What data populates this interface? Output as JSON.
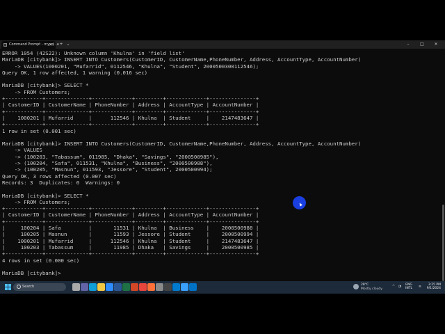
{
  "window": {
    "tab_title": "Command Prompt - mysql -u",
    "close_tab": "×",
    "new_tab": "+",
    "dropdown": "⌄",
    "minimize": "–",
    "maximize": "□",
    "close": "✕"
  },
  "console": {
    "lines": [
      "ERROR 1054 (42S22): Unknown column 'Khulna' in 'field list'",
      "MariaDB [citybank]> INSERT INTO Customers(CustomerID, CustomerName,PhoneNumber, Address, AccountType, AccountNumber)",
      "    -> VALUES(1000201, \"Mufarrid\", 0112546, \"Khulna\", \"Student\", 2000500300112546);",
      "Query OK, 1 row affected, 1 warning (0.016 sec)",
      "",
      "MariaDB [citybank]> SELECT *",
      "    -> FROM Customers;",
      "+------------+--------------+-------------+---------+-------------+---------------+",
      "| CustomerID | CustomerName | PhoneNumber | Address | AccountType | AccountNumber |",
      "+------------+--------------+-------------+---------+-------------+---------------+",
      "|    1000201 | Mufarrid     |      112546 | Khulna  | Student     |    2147483647 |",
      "+------------+--------------+-------------+---------+-------------+---------------+",
      "1 row in set (0.001 sec)",
      "",
      "MariaDB [citybank]> INSERT INTO Customers(CustomerID, CustomerName,PhoneNumber, Address, AccountType, AccountNumber)",
      "    -> VALUES",
      "    -> (100203, \"Tabassum\", 011985, \"Dhaka\", \"Savings\", \"2000500985\"),",
      "    -> (100204, \"Safa\", 011531, \"Khulna\", \"Business\", \"2000500988\"),",
      "    -> (100205, \"Masnun\", 011593, \"Jessore\", \"Student\", 2000500994);",
      "Query OK, 3 rows affected (0.007 sec)",
      "Records: 3  Duplicates: 0  Warnings: 0",
      "",
      "MariaDB [citybank]> SELECT *",
      "    -> FROM Customers;",
      "+------------+--------------+-------------+---------+-------------+---------------+",
      "| CustomerID | CustomerName | PhoneNumber | Address | AccountType | AccountNumber |",
      "+------------+--------------+-------------+---------+-------------+---------------+",
      "|     100204 | Safa         |       11531 | Khulna  | Business    |    2000500988 |",
      "|     100205 | Masnun       |       11593 | Jessore | Student     |    2000500994 |",
      "|    1000201 | Mufarrid     |      112546 | Khulna  | Student     |    2147483647 |",
      "|     100203 | Tabassum     |       11985 | Dhaka   | Savings     |    2000500985 |",
      "+------------+--------------+-------------+---------+-------------+---------------+",
      "4 rows in set (0.000 sec)",
      "",
      "MariaDB [citybank]> "
    ]
  },
  "taskbar": {
    "search_label": "Search",
    "apps": [
      "task-view",
      "teams",
      "edge",
      "file-explorer",
      "store",
      "word",
      "excel",
      "powerpoint",
      "chrome",
      "firefox",
      "settings",
      "terminal",
      "vscode",
      "photos",
      "mail"
    ],
    "weather_temp": "28°C",
    "weather_desc": "Mostly cloudy",
    "tray_chevron": "^",
    "lang_line1": "ENG",
    "lang_line2": "INTL",
    "time": "3:25 PM",
    "date": "9/1/2024"
  },
  "colors": {
    "console_bg": "#0c0c0c",
    "console_text": "#cccccc",
    "titlebar": "#202020",
    "taskbar": "#1c2a3a",
    "cursor_highlight": "#1a3fe0"
  }
}
